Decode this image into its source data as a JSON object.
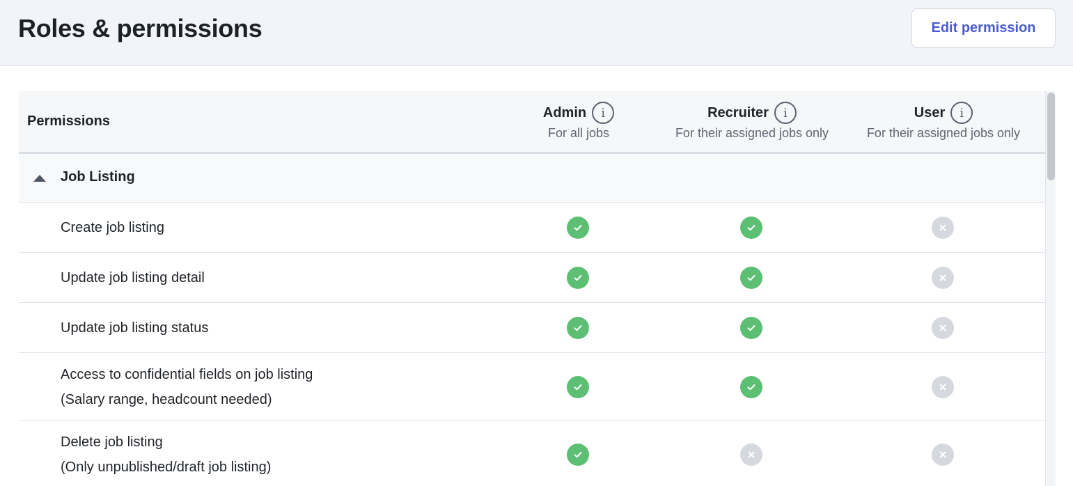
{
  "header": {
    "title": "Roles & permissions",
    "edit_label": "Edit permission"
  },
  "table": {
    "perm_header": "Permissions",
    "roles": [
      {
        "name": "Admin",
        "scope": "For all jobs"
      },
      {
        "name": "Recruiter",
        "scope": "For their assigned jobs only"
      },
      {
        "name": "User",
        "scope": "For their assigned jobs only"
      }
    ],
    "section": {
      "label": "Job Listing",
      "expanded": true
    },
    "rows": [
      {
        "label": "Create job listing",
        "sub": "",
        "admin": true,
        "recruiter": true,
        "user": false
      },
      {
        "label": "Update job listing detail",
        "sub": "",
        "admin": true,
        "recruiter": true,
        "user": false
      },
      {
        "label": "Update job listing status",
        "sub": "",
        "admin": true,
        "recruiter": true,
        "user": false
      },
      {
        "label": "Access to confidential fields on job listing",
        "sub": "(Salary range, headcount needed)",
        "admin": true,
        "recruiter": true,
        "user": false
      },
      {
        "label": "Delete job listing",
        "sub": "(Only unpublished/draft job listing)",
        "admin": true,
        "recruiter": false,
        "user": false
      }
    ]
  },
  "icons": {
    "info": "info-icon",
    "granted": "check-circle-icon",
    "denied": "x-circle-icon",
    "collapse": "caret-up-icon"
  },
  "colors": {
    "accent": "#4a5bd0",
    "granted": "#5cbf73",
    "denied": "#d5d9df",
    "header_bg": "#f1f4f9"
  }
}
